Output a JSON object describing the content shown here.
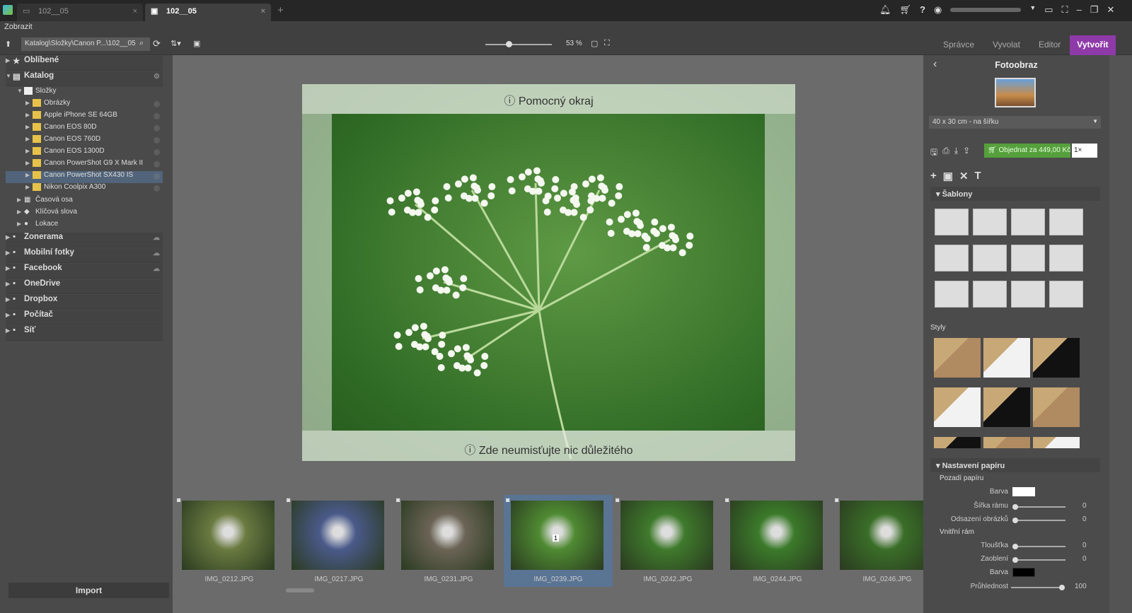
{
  "tabs": [
    {
      "label": "102__05",
      "active": false
    },
    {
      "label": "102__05",
      "active": true
    }
  ],
  "window": {
    "email_blurred": "",
    "icons": [
      "bell-icon",
      "cart-icon",
      "help-icon",
      "user-icon",
      "monitor-icon",
      "fullscreen-icon",
      "minimize-icon",
      "restore-icon",
      "close-icon"
    ]
  },
  "menu": {
    "view": "Zobrazit"
  },
  "toolbar": {
    "path": "Katalog\\Složky\\Canon P...\\102__05",
    "zoom": "53 %",
    "zoom_fraction": 0.35
  },
  "modes": {
    "items": [
      "Správce",
      "Vyvolat",
      "Editor",
      "Vytvořit"
    ],
    "active": "Vytvořit",
    "accent": "#8e3aa8"
  },
  "sidebar": {
    "favorites": "Oblíbené",
    "catalog": "Katalog",
    "folders": "Složky",
    "folder_items": [
      "Obrázky",
      "Apple iPhone SE 64GB",
      "Canon EOS 80D",
      "Canon EOS 760D",
      "Canon EOS 1300D",
      "Canon PowerShot G9 X Mark II",
      "Canon PowerShot SX430 IS",
      "Nikon Coolpix A300"
    ],
    "selected": "Canon PowerShot SX430 IS",
    "timeline": "Časová osa",
    "keywords": "Klíčová slova",
    "location": "Lokace",
    "sources": [
      "Zonerama",
      "Mobilní fotky",
      "Facebook",
      "OneDrive",
      "Dropbox",
      "Počítač",
      "Síť"
    ],
    "import": "Import"
  },
  "canvas": {
    "top_note": "Pomocný okraj",
    "bottom_note": "Zde neumisťujte nic důležitého"
  },
  "filmstrip": [
    {
      "name": "IMG_0212.JPG",
      "c": "#6a7a40"
    },
    {
      "name": "IMG_0217.JPG",
      "c": "#4a5a8a"
    },
    {
      "name": "IMG_0231.JPG",
      "c": "#6b6456"
    },
    {
      "name": "IMG_0239.JPG",
      "c": "#4f8a32",
      "selected": true,
      "badge": "1"
    },
    {
      "name": "IMG_0242.JPG",
      "c": "#3f7a2c"
    },
    {
      "name": "IMG_0244.JPG",
      "c": "#3b7a2a"
    },
    {
      "name": "IMG_0246.JPG",
      "c": "#3a6e28"
    }
  ],
  "panel": {
    "title": "Fotoobraz",
    "size": "40 x 30 cm - na šířku",
    "order": "Objednat za 449,00 Kč",
    "qty": "1×",
    "order_color": "#55a03c",
    "templates": "Šablony",
    "styles": "Styly",
    "paper": "Nastavení papíru",
    "paper_bg": "Pozadí papíru",
    "color": "Barva",
    "frame_width": "Šířka rámu",
    "offset": "Odsazení obrázků",
    "inner": "Vnitřní rám",
    "thickness": "Tloušťka",
    "rounding": "Zaoblení",
    "color2": "Barva",
    "opacity": "Průhlednost",
    "values": {
      "frame_width": "0",
      "offset": "0",
      "thickness": "0",
      "rounding": "0",
      "opacity": "100"
    },
    "bg_color": "#ffffff",
    "inner_color": "#000000"
  }
}
